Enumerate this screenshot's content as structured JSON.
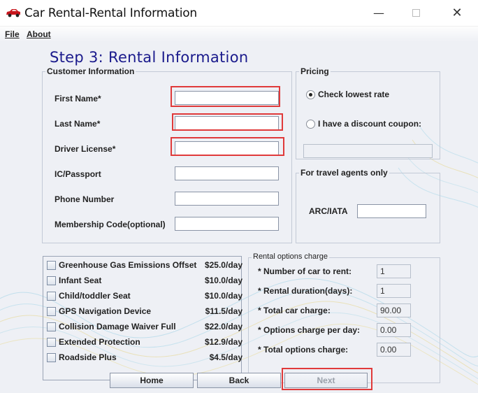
{
  "window": {
    "title": "Car Rental-Rental Information",
    "min_glyph": "—",
    "close_glyph": "✕"
  },
  "menubar": {
    "file": "File",
    "about": "About"
  },
  "page": {
    "heading": "Step 3: Rental Information"
  },
  "customer_info": {
    "legend": "Customer Information",
    "fields": [
      {
        "label": "First Name*",
        "value": ""
      },
      {
        "label": "Last Name*",
        "value": ""
      },
      {
        "label": "Driver License*",
        "value": ""
      },
      {
        "label": "IC/Passport",
        "value": ""
      },
      {
        "label": "Phone Number",
        "value": ""
      },
      {
        "label": "Membership Code(optional)",
        "value": ""
      }
    ]
  },
  "pricing": {
    "legend": "Pricing",
    "options": [
      {
        "label": "Check lowest rate",
        "selected": true
      },
      {
        "label": "I have a discount coupon:",
        "selected": false
      }
    ],
    "coupon_value": ""
  },
  "travel_agents": {
    "legend": "For travel agents only",
    "arc_label": "ARC/IATA",
    "arc_value": ""
  },
  "rental_options": [
    {
      "name": "Greenhouse Gas Emissions Offset",
      "price": "$25.0/day",
      "checked": false
    },
    {
      "name": "Infant Seat",
      "price": "$10.0/day",
      "checked": false
    },
    {
      "name": "Child/toddler Seat",
      "price": "$10.0/day",
      "checked": false
    },
    {
      "name": "GPS Navigation Device",
      "price": "$11.5/day",
      "checked": false
    },
    {
      "name": "Collision Damage Waiver Full",
      "price": "$22.0/day",
      "checked": false
    },
    {
      "name": "Extended Protection",
      "price": "$12.9/day",
      "checked": false
    },
    {
      "name": "Roadside Plus",
      "price": "$4.5/day",
      "checked": false
    }
  ],
  "charges": {
    "legend": "Rental options charge",
    "rows": [
      {
        "label": "* Number of car to rent:",
        "value": "1"
      },
      {
        "label": "* Rental duration(days):",
        "value": "1"
      },
      {
        "label": "* Total car charge:",
        "value": "90.00"
      },
      {
        "label": "* Options charge per day:",
        "value": "0.00"
      },
      {
        "label": "* Total options charge:",
        "value": "0.00"
      }
    ]
  },
  "buttons": {
    "home": "Home",
    "back": "Back",
    "next": "Next",
    "next_enabled": false
  },
  "colors": {
    "heading": "#1a1a8c",
    "highlight": "#e03a3a",
    "background": "#eef0f5"
  },
  "icons": {
    "app": "red-car-icon",
    "minimize": "minimize-icon",
    "maximize": "maximize-icon",
    "close": "close-icon"
  }
}
